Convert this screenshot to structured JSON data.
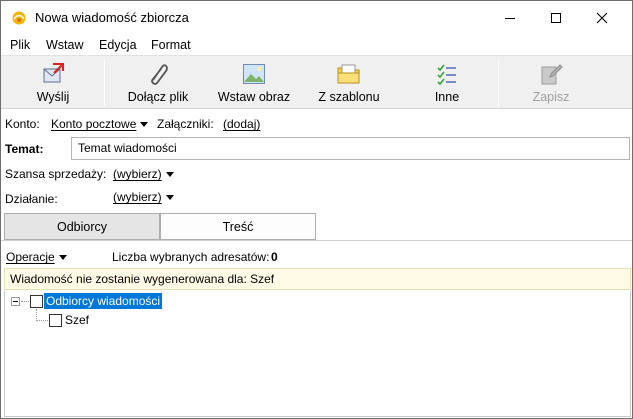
{
  "window": {
    "title": "Nowa wiadomość zbiorcza"
  },
  "menu": {
    "items": [
      "Plik",
      "Wstaw",
      "Edycja",
      "Format"
    ]
  },
  "toolbar": {
    "send": "Wyślij",
    "attach": "Dołącz plik",
    "insert_image": "Wstaw obraz",
    "template": "Z szablonu",
    "other": "Inne",
    "save": "Zapisz"
  },
  "form": {
    "account_label": "Konto:",
    "account_value": "Konto pocztowe",
    "attachments_label": "Załączniki:",
    "attachments_link": "(dodaj)",
    "subject_label": "Temat:",
    "subject_value": "Temat wiadomości",
    "chance_label": "Szansa sprzedaży:",
    "chance_value": "(wybierz)",
    "action_label": "Działanie:",
    "action_value": "(wybierz)"
  },
  "tabs": {
    "recipients": "Odbiorcy",
    "content": "Treść"
  },
  "recipients": {
    "operations": "Operacje",
    "count_label": "Liczba wybranych adresatów:",
    "count_value": "0",
    "notice": "Wiadomość nie zostanie wygenerowana dla: Szef",
    "tree_root": "Odbiorcy wiadomości",
    "tree_child": "Szef"
  }
}
